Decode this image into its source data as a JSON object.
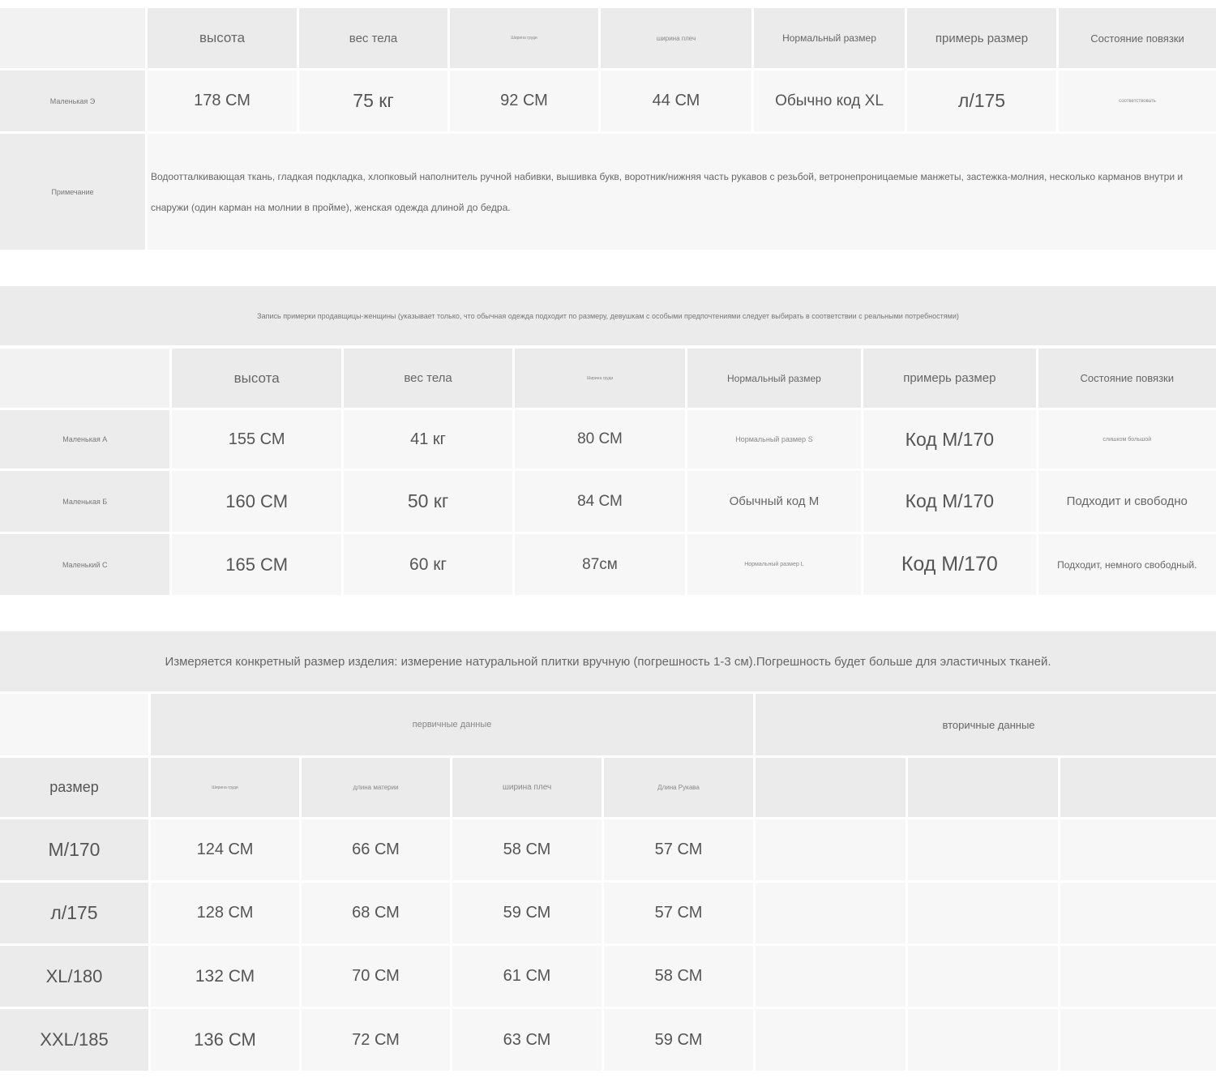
{
  "table1": {
    "headers": [
      "высота",
      "вес тела",
      "Ширина груди",
      "ширина плеч",
      "Нормальный размер",
      "примерь размер",
      "Состояние повязки"
    ],
    "row": {
      "label": "Маленькая Э",
      "cells": [
        "178 СМ",
        "75 кг",
        "92 СМ",
        "44 СМ",
        "Обычно код XL",
        "л/175",
        "соответствовать"
      ]
    },
    "note_label": "Примечание",
    "note_text": "Водоотталкивающая ткань, гладкая подкладка, хлопковый наполнитель ручной набивки, вышивка букв, воротник/нижняя часть рукавов с резьбой, ветронепроницаемые манжеты, застежка-молния, несколько карманов внутри и снаружи (один карман на молнии в пройме), женская одежда длиной до бедра."
  },
  "table2": {
    "banner": "Запись примерки продавщицы-женщины (указывает только, что обычная одежда подходит по размеру, девушкам с особыми предпочтениями следует выбирать в соответствии с реальными потребностями)",
    "headers": [
      "высота",
      "вес тела",
      "Ширина груди",
      "Нормальный размер",
      "примерь размер",
      "Состояние повязки"
    ],
    "rows": [
      {
        "label": "Маленькая А",
        "cells": [
          "155 СМ",
          "41 кг",
          "80 СМ",
          "Нормальный размер S",
          "Код М/170",
          "слишком большой"
        ]
      },
      {
        "label": "Маленькая Б",
        "cells": [
          "160 СМ",
          "50 кг",
          "84 СМ",
          "Обычный код М",
          "Код М/170",
          "Подходит и свободно"
        ]
      },
      {
        "label": "Маленький С",
        "cells": [
          "165 СМ",
          "60 кг",
          "87см",
          "Нормальный размер L",
          "Код М/170",
          "Подходит, немного свободный."
        ]
      }
    ]
  },
  "table3": {
    "banner": "Измеряется конкретный размер изделия: измерение натуральной плитки вручную (погрешность 1-3 см).Погрешность будет больше для эластичных тканей.",
    "group_primary": "первичные данные",
    "group_secondary": "вторичные данные",
    "headers": [
      "размер",
      "Ширина груди",
      "длина материи",
      "ширина плеч",
      "Длина Рукава"
    ],
    "rows": [
      {
        "size": "М/170",
        "cells": [
          "124 СМ",
          "66 СМ",
          "58 СМ",
          "57 СМ"
        ]
      },
      {
        "size": "л/175",
        "cells": [
          "128 СМ",
          "68 СМ",
          "59 СМ",
          "57 СМ"
        ]
      },
      {
        "size": "XL/180",
        "cells": [
          "132 СМ",
          "70 СМ",
          "61 СМ",
          "58 СМ"
        ]
      },
      {
        "size": "XXL/185",
        "cells": [
          "136 СМ",
          "72 СМ",
          "63 СМ",
          "59 СМ"
        ]
      }
    ]
  }
}
